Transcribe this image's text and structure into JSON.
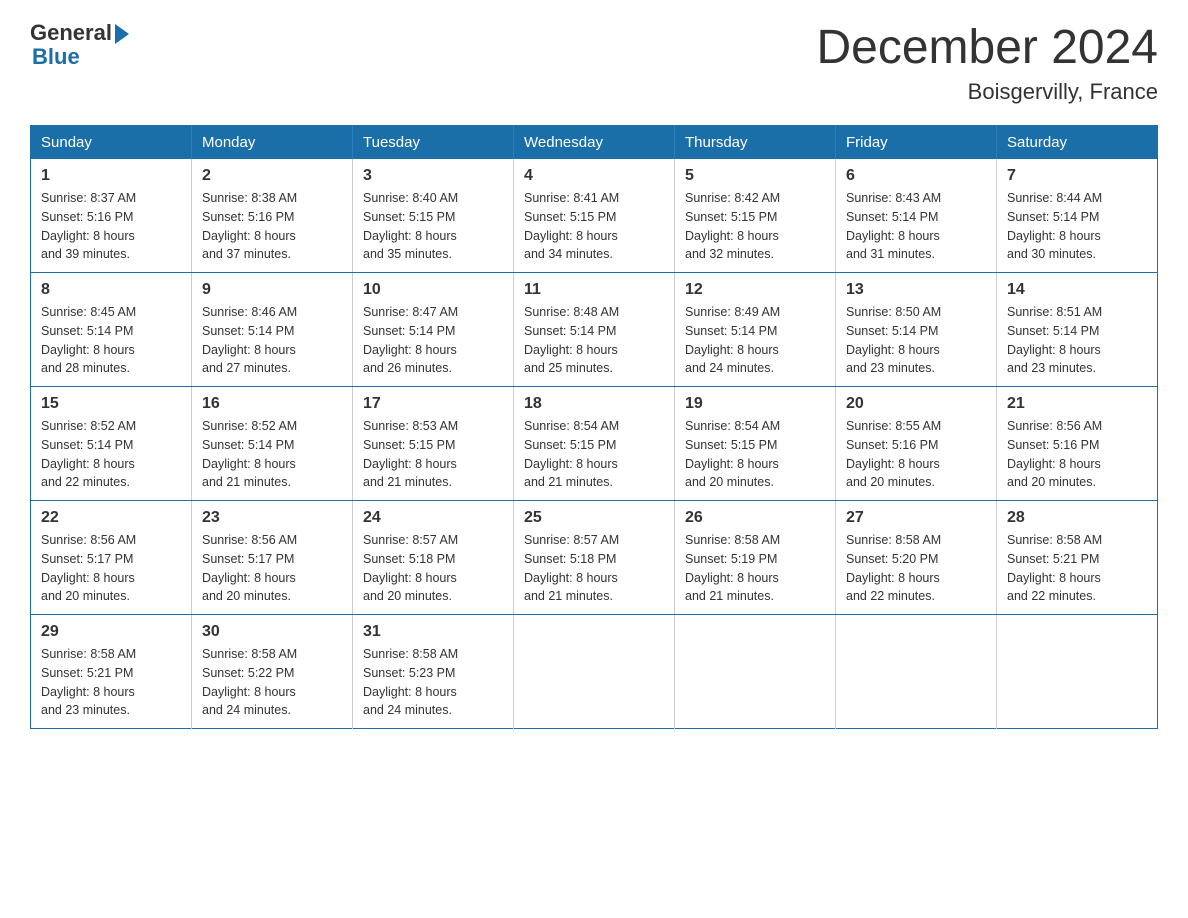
{
  "header": {
    "logo_general": "General",
    "logo_blue": "Blue",
    "title": "December 2024",
    "location": "Boisgervilly, France"
  },
  "days_of_week": [
    "Sunday",
    "Monday",
    "Tuesday",
    "Wednesday",
    "Thursday",
    "Friday",
    "Saturday"
  ],
  "weeks": [
    [
      {
        "day": "1",
        "sunrise": "8:37 AM",
        "sunset": "5:16 PM",
        "daylight": "8 hours and 39 minutes."
      },
      {
        "day": "2",
        "sunrise": "8:38 AM",
        "sunset": "5:16 PM",
        "daylight": "8 hours and 37 minutes."
      },
      {
        "day": "3",
        "sunrise": "8:40 AM",
        "sunset": "5:15 PM",
        "daylight": "8 hours and 35 minutes."
      },
      {
        "day": "4",
        "sunrise": "8:41 AM",
        "sunset": "5:15 PM",
        "daylight": "8 hours and 34 minutes."
      },
      {
        "day": "5",
        "sunrise": "8:42 AM",
        "sunset": "5:15 PM",
        "daylight": "8 hours and 32 minutes."
      },
      {
        "day": "6",
        "sunrise": "8:43 AM",
        "sunset": "5:14 PM",
        "daylight": "8 hours and 31 minutes."
      },
      {
        "day": "7",
        "sunrise": "8:44 AM",
        "sunset": "5:14 PM",
        "daylight": "8 hours and 30 minutes."
      }
    ],
    [
      {
        "day": "8",
        "sunrise": "8:45 AM",
        "sunset": "5:14 PM",
        "daylight": "8 hours and 28 minutes."
      },
      {
        "day": "9",
        "sunrise": "8:46 AM",
        "sunset": "5:14 PM",
        "daylight": "8 hours and 27 minutes."
      },
      {
        "day": "10",
        "sunrise": "8:47 AM",
        "sunset": "5:14 PM",
        "daylight": "8 hours and 26 minutes."
      },
      {
        "day": "11",
        "sunrise": "8:48 AM",
        "sunset": "5:14 PM",
        "daylight": "8 hours and 25 minutes."
      },
      {
        "day": "12",
        "sunrise": "8:49 AM",
        "sunset": "5:14 PM",
        "daylight": "8 hours and 24 minutes."
      },
      {
        "day": "13",
        "sunrise": "8:50 AM",
        "sunset": "5:14 PM",
        "daylight": "8 hours and 23 minutes."
      },
      {
        "day": "14",
        "sunrise": "8:51 AM",
        "sunset": "5:14 PM",
        "daylight": "8 hours and 23 minutes."
      }
    ],
    [
      {
        "day": "15",
        "sunrise": "8:52 AM",
        "sunset": "5:14 PM",
        "daylight": "8 hours and 22 minutes."
      },
      {
        "day": "16",
        "sunrise": "8:52 AM",
        "sunset": "5:14 PM",
        "daylight": "8 hours and 21 minutes."
      },
      {
        "day": "17",
        "sunrise": "8:53 AM",
        "sunset": "5:15 PM",
        "daylight": "8 hours and 21 minutes."
      },
      {
        "day": "18",
        "sunrise": "8:54 AM",
        "sunset": "5:15 PM",
        "daylight": "8 hours and 21 minutes."
      },
      {
        "day": "19",
        "sunrise": "8:54 AM",
        "sunset": "5:15 PM",
        "daylight": "8 hours and 20 minutes."
      },
      {
        "day": "20",
        "sunrise": "8:55 AM",
        "sunset": "5:16 PM",
        "daylight": "8 hours and 20 minutes."
      },
      {
        "day": "21",
        "sunrise": "8:56 AM",
        "sunset": "5:16 PM",
        "daylight": "8 hours and 20 minutes."
      }
    ],
    [
      {
        "day": "22",
        "sunrise": "8:56 AM",
        "sunset": "5:17 PM",
        "daylight": "8 hours and 20 minutes."
      },
      {
        "day": "23",
        "sunrise": "8:56 AM",
        "sunset": "5:17 PM",
        "daylight": "8 hours and 20 minutes."
      },
      {
        "day": "24",
        "sunrise": "8:57 AM",
        "sunset": "5:18 PM",
        "daylight": "8 hours and 20 minutes."
      },
      {
        "day": "25",
        "sunrise": "8:57 AM",
        "sunset": "5:18 PM",
        "daylight": "8 hours and 21 minutes."
      },
      {
        "day": "26",
        "sunrise": "8:58 AM",
        "sunset": "5:19 PM",
        "daylight": "8 hours and 21 minutes."
      },
      {
        "day": "27",
        "sunrise": "8:58 AM",
        "sunset": "5:20 PM",
        "daylight": "8 hours and 22 minutes."
      },
      {
        "day": "28",
        "sunrise": "8:58 AM",
        "sunset": "5:21 PM",
        "daylight": "8 hours and 22 minutes."
      }
    ],
    [
      {
        "day": "29",
        "sunrise": "8:58 AM",
        "sunset": "5:21 PM",
        "daylight": "8 hours and 23 minutes."
      },
      {
        "day": "30",
        "sunrise": "8:58 AM",
        "sunset": "5:22 PM",
        "daylight": "8 hours and 24 minutes."
      },
      {
        "day": "31",
        "sunrise": "8:58 AM",
        "sunset": "5:23 PM",
        "daylight": "8 hours and 24 minutes."
      },
      null,
      null,
      null,
      null
    ]
  ],
  "labels": {
    "sunrise": "Sunrise:",
    "sunset": "Sunset:",
    "daylight": "Daylight:"
  }
}
